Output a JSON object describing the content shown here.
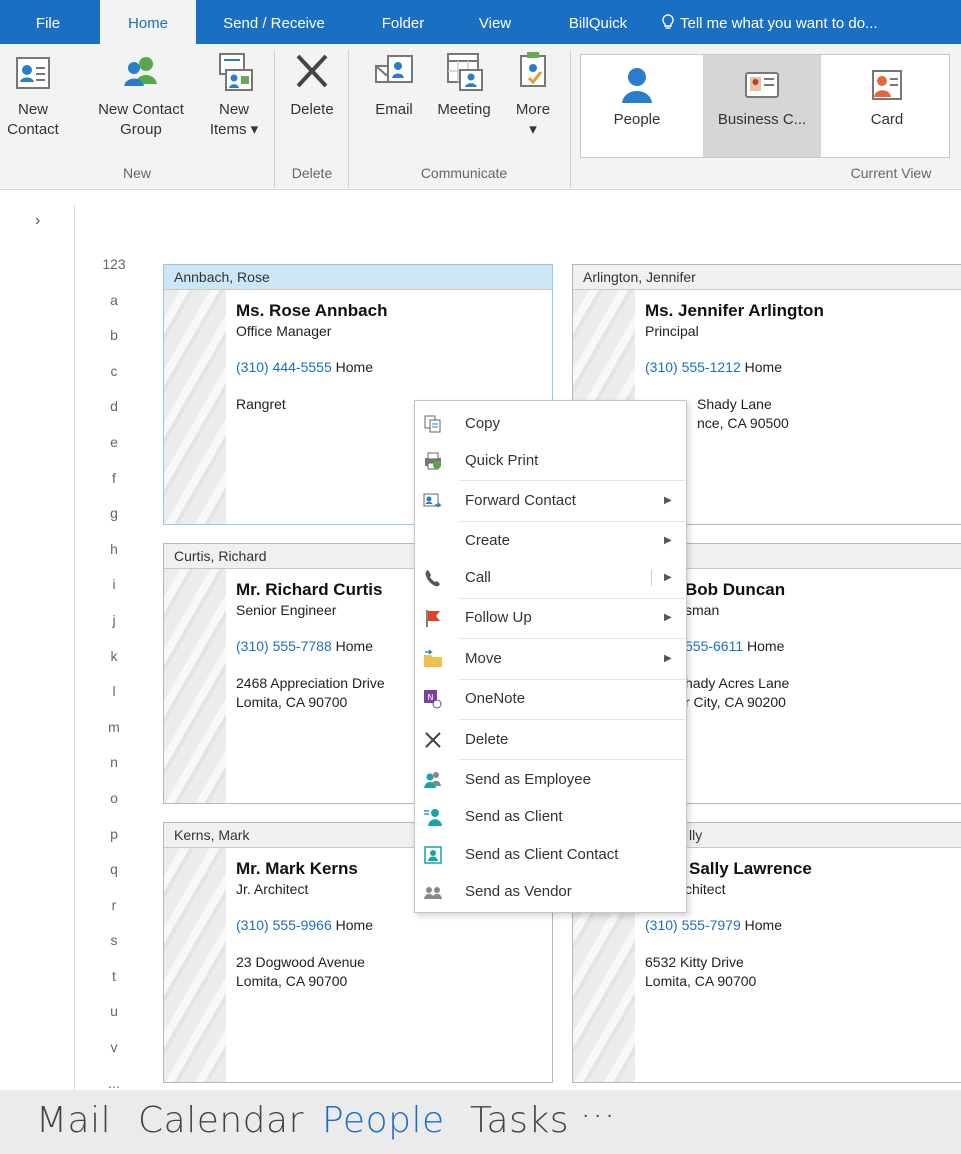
{
  "ribbon_tabs": {
    "file": "File",
    "home": "Home",
    "send_receive": "Send / Receive",
    "folder": "Folder",
    "view": "View",
    "billquick": "BillQuick",
    "tell_me": "Tell me what you want to do..."
  },
  "ribbon": {
    "new_contact": "New\nContact",
    "new_contact_group": "New Contact\nGroup",
    "new_items": "New\nItems ▾",
    "delete": "Delete",
    "email": "Email",
    "meeting": "Meeting",
    "more": "More\n▾",
    "group_new": "New",
    "group_delete": "Delete",
    "group_communicate": "Communicate",
    "group_current_view": "Current View",
    "view_people": "People",
    "view_business_card": "Business C...",
    "view_card": "Card"
  },
  "nav": {
    "expand": "›"
  },
  "alpha_index": [
    "123",
    "a",
    "b",
    "c",
    "d",
    "e",
    "f",
    "g",
    "h",
    "i",
    "j",
    "k",
    "l",
    "m",
    "n",
    "o",
    "p",
    "q",
    "r",
    "s",
    "t",
    "u",
    "v",
    "..."
  ],
  "cards": [
    {
      "header": "Annbach, Rose",
      "name": "Ms. Rose Annbach",
      "title": "Office Manager",
      "phone": "(310) 444-5555",
      "phone_type": "Home",
      "addr1": "Rangret",
      "addr2": ""
    },
    {
      "header": "Arlington, Jennifer",
      "name": "Ms. Jennifer Arlington",
      "title": "Principal",
      "phone": "(310) 555-1212",
      "phone_type": "Home",
      "addr1": "Shady Lane",
      "addr2": "nce, CA 90500"
    },
    {
      "header": "Curtis, Richard",
      "name": "Mr. Richard Curtis",
      "title": "Senior Engineer",
      "phone": "(310) 555-7788",
      "phone_type": "Home",
      "addr1": "2468 Appreciation Drive",
      "addr2": "Lomita, CA 90700"
    },
    {
      "header": "",
      "name": "Bob Duncan",
      "title": "sman",
      "phone": "555-6611",
      "phone_type": "Home",
      "addr1": "hady Acres Lane",
      "addr2": "r City, CA 90200"
    },
    {
      "header": "Kerns, Mark",
      "name": "Mr. Mark Kerns",
      "title": "Jr. Architect",
      "phone": "(310) 555-9966",
      "phone_type": "Home",
      "addr1": "23 Dogwood Avenue",
      "addr2": "Lomita, CA 90700"
    },
    {
      "header": "lly",
      "name": "Sally Lawrence",
      "title": "chitect",
      "phone": "(310) 555-7979",
      "phone_type": "Home",
      "addr1": "6532 Kitty Drive",
      "addr2": "Lomita, CA 90700"
    }
  ],
  "context_menu": {
    "copy": "Copy",
    "quick_print": "Quick Print",
    "forward_contact": "Forward Contact",
    "create": "Create",
    "call": "Call",
    "follow_up": "Follow Up",
    "move": "Move",
    "onenote": "OneNote",
    "delete": "Delete",
    "send_employee": "Send as Employee",
    "send_client": "Send as Client",
    "send_client_contact": "Send as Client Contact",
    "send_vendor": "Send as Vendor",
    "submenu_arrow": "▶"
  },
  "bottom_nav": {
    "mail": "Mail",
    "calendar": "Calendar",
    "people": "People",
    "tasks": "Tasks",
    "more": "···"
  },
  "colors": {
    "accent": "#1b6fc2",
    "selected_header": "#cde6f7",
    "ribbon_bg": "#f3f3f3"
  }
}
